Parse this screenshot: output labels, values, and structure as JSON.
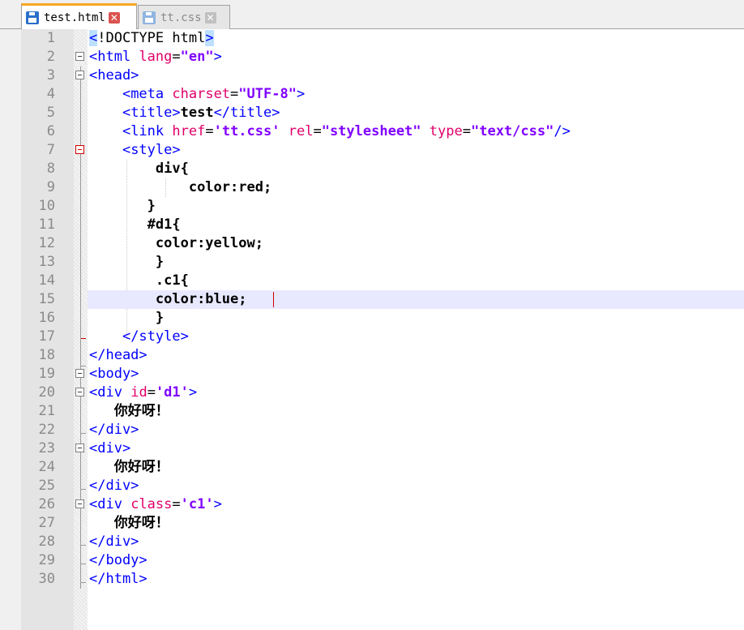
{
  "tabs": [
    {
      "label": "test.html",
      "active": true,
      "icon": "save-icon",
      "close": "close-icon"
    },
    {
      "label": "tt.css",
      "active": false,
      "icon": "save-icon",
      "close": "close-icon"
    }
  ],
  "colors": {
    "tag": "#0000ff",
    "attr": "#e0006a",
    "value": "#8000ff",
    "current_line": "#e8e8ff",
    "fold_active": "#d00000"
  },
  "editor": {
    "current_line": 15,
    "lines": [
      {
        "n": "1"
      },
      {
        "n": "2"
      },
      {
        "n": "3"
      },
      {
        "n": "4"
      },
      {
        "n": "5"
      },
      {
        "n": "6"
      },
      {
        "n": "7"
      },
      {
        "n": "8"
      },
      {
        "n": "9"
      },
      {
        "n": "10"
      },
      {
        "n": "11"
      },
      {
        "n": "12"
      },
      {
        "n": "13"
      },
      {
        "n": "14"
      },
      {
        "n": "15"
      },
      {
        "n": "16"
      },
      {
        "n": "17"
      },
      {
        "n": "18"
      },
      {
        "n": "19"
      },
      {
        "n": "20"
      },
      {
        "n": "21"
      },
      {
        "n": "22"
      },
      {
        "n": "23"
      },
      {
        "n": "24"
      },
      {
        "n": "25"
      },
      {
        "n": "26"
      },
      {
        "n": "27"
      },
      {
        "n": "28"
      },
      {
        "n": "29"
      },
      {
        "n": "30"
      }
    ],
    "tok": {
      "doctype_open": "<",
      "doctype_bang": "!DOCTYPE html",
      "doctype_close": ">",
      "html_open": "<html",
      "lang_attr": "lang",
      "eq": "=",
      "lang_val": "\"en\"",
      "gt": ">",
      "head_open": "<head>",
      "meta_open": "<meta",
      "charset_attr": "charset",
      "charset_val": "\"UTF-8\"",
      "title_open": "<title>",
      "title_text": "test",
      "title_close": "</title>",
      "link_open": "<link",
      "href_attr": "href",
      "href_val": "'tt.css'",
      "rel_attr": "rel",
      "rel_val": "\"stylesheet\"",
      "type_attr": "type",
      "type_val": "\"text/css\"",
      "selfclose": "/>",
      "style_open": "<style>",
      "css_div": "div{",
      "css_color_red": "color:red;",
      "css_close": "}",
      "css_d1": "#d1{",
      "css_color_yellow": "color:yellow;",
      "css_c1": ".c1{",
      "css_color_blue": "color:blue;",
      "style_close": "</style>",
      "head_close": "</head>",
      "body_open": "<body>",
      "div_open": "<div",
      "id_attr": "id",
      "id_val": "'d1'",
      "greeting": "你好呀！",
      "div_close": "</div>",
      "div_plain": "<div>",
      "class_attr": "class",
      "class_val": "'c1'",
      "body_close": "</body>",
      "html_close": "</html>"
    }
  }
}
